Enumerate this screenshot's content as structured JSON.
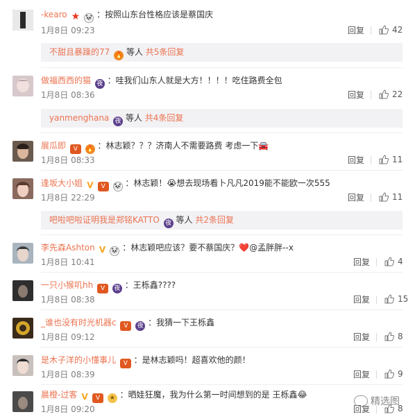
{
  "actions": {
    "reply": "回复"
  },
  "comments": [
    {
      "user": "-kearo",
      "badges": [
        "star",
        "panda"
      ],
      "text": "：按照山东台性格应该是蔡国庆",
      "time": "1月8日 09:23",
      "likes": "42",
      "sub": {
        "prefix": "不甜且暴躁的77",
        "mid": " 等人 ",
        "count": "共5条回复",
        "badges": [
          "fire"
        ]
      },
      "avatar": "#3a3a3a"
    },
    {
      "user": "做福西西的猫",
      "badges": [
        "night"
      ],
      "text": "：哇我们山东人就是大方！！！！吃住路费全包",
      "time": "1月8日 08:36",
      "likes": "22",
      "sub": {
        "prefix": "yanmenghana",
        "mid": " 等人 ",
        "count": "共4条回复",
        "badges": [
          "night"
        ]
      },
      "avatar": "#c9b8c0"
    },
    {
      "user": "展瓜即",
      "badges": [
        "vip",
        "fire"
      ],
      "text": "：林志颖？？？济南人不需要路费 考虑一下🚘",
      "time": "1月8日 08:33",
      "likes": "11",
      "avatar": "#5a4a3e"
    },
    {
      "user": "逢坂大小姐",
      "badges": [
        "v",
        "vip",
        "panda"
      ],
      "text": "：林志颖！😭想去现场看卜凡凡2019能不能欧一次555",
      "time": "1月8日 22:29",
      "likes": "11",
      "sub": {
        "prefix": "吧啦吧啦证明我是郑铭KATTO",
        "mid": " 等人 ",
        "count": "共2条回复",
        "badges": [
          "night"
        ]
      },
      "avatar": "#7a5f55"
    },
    {
      "user": "李先森Ashton",
      "badges": [
        "v",
        "panda"
      ],
      "text": "：林志颖吧应该？要不蔡国庆？❤️@孟胖胖--x",
      "time": "1月8日 10:41",
      "likes": "4",
      "avatar": "#9aa6b2"
    },
    {
      "user": "一只小猴叽hh",
      "badges": [
        "vip",
        "night"
      ],
      "text": "：王栎鑫????",
      "time": "1月8日 08:38",
      "likes": "15",
      "avatar": "#2e2e2e"
    },
    {
      "user": "_谁也没有时光机器c",
      "badges": [
        "vip",
        "night"
      ],
      "text": "：我猜一下王栎鑫",
      "time": "1月8日 09:12",
      "likes": "8",
      "avatar": "#d4a62a"
    },
    {
      "user": "是木子洋的小懂事儿",
      "badges": [
        "vip"
      ],
      "text": "：是林志颖吗！超喜欢他的颜！",
      "time": "1月8日 08:39",
      "likes": "9",
      "avatar": "#b0a8a4"
    },
    {
      "user": "晨橙-过客",
      "badges": [
        "v",
        "vip",
        "medal"
      ],
      "text": "：晒娃狂魔，我为什么第一时间想到的是 王栎鑫😂",
      "time": "1月8日 09:20",
      "likes": "8",
      "avatar": "#4a4a4a"
    }
  ],
  "watermark": "精选图"
}
